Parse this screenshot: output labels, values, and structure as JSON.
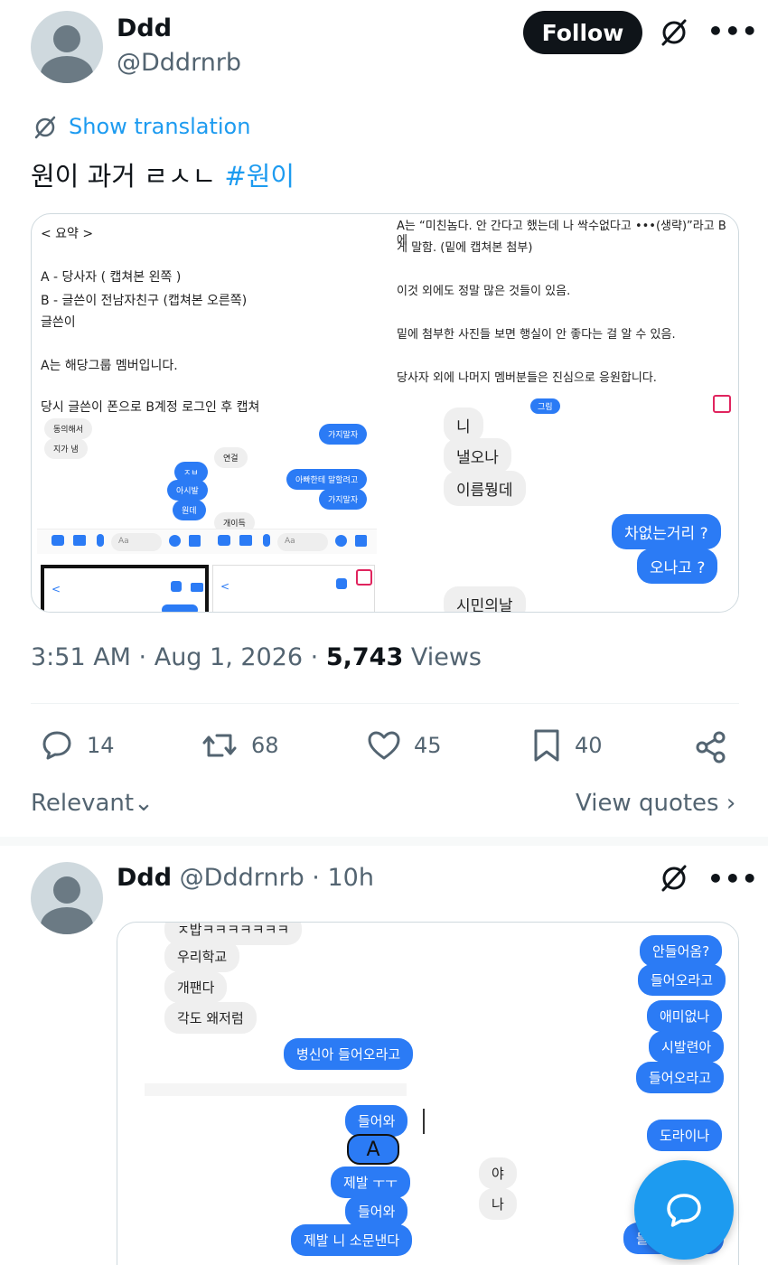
{
  "tweet": {
    "author_name": "Ddd",
    "author_handle": "@Dddrnrb",
    "follow_label": "Follow",
    "show_translation": "Show translation",
    "text_main": "원이 과거 ㄹㅅㄴ ",
    "hashtag": "#원이",
    "timestamp": "3:51 AM · Aug 1, 2026 · ",
    "views_count": "5,743",
    "views_label": " Views",
    "replies": "14",
    "retweets": "68",
    "likes": "45",
    "bookmarks": "40"
  },
  "filters": {
    "sort_label": "Relevant",
    "view_quotes": "View quotes"
  },
  "reply": {
    "author_name": "Ddd",
    "author_handle": "@Dddrnrb",
    "time": " · 10h"
  },
  "media1": {
    "left_doc": [
      "< 요약 >",
      "A - 당사자 ( 캡쳐본 왼쪽 )",
      "B - 글쓴이 전남자친구 (캡쳐본 오른쪽)",
      "글쓴이",
      "A는 해당그룹 멤버입니다.",
      "당시 글쓴이 폰으로 B계정 로그인 후 캡쳐"
    ],
    "right_doc": [
      "A는 “미친놈다. 안 간다고 했는데 나 싹수없다고 •••(생략)”라고 B에",
      "게 말함. (밑에 캡쳐본 첨부)",
      "이것 외에도 정말 많은 것들이 있음.",
      "밑에 첨부한 사진들 보면 행실이 안 좋다는 걸 알 수 있음.",
      "당사자 외에 나머지 멤버분들은 진심으로 응원합니다."
    ],
    "left_chat": [
      "동의해서",
      "지가 냄",
      "가지말자",
      "ㅈㅂ",
      "아시발",
      "원데",
      "연걸",
      "아빠한테 말할려고",
      "가지말자",
      "개이득",
      "Aa",
      "Aa"
    ],
    "right_chat": [
      "그림",
      "니",
      "낼오나",
      "이름뭥데",
      "차없는거리 ?",
      "오나고 ?",
      "시민의날"
    ]
  },
  "media2": {
    "left_chat": [
      "ㅈ밥ㅋㅋㅋㅋㅋㅋㅋ",
      "우리학교",
      "개팬다",
      "각도 왜저럼",
      "병신아 들어오라고",
      "들어와",
      "A",
      "제발 ㅜㅜ",
      "들어와",
      "제발 니 소문낸다",
      "야",
      "나"
    ],
    "right_chat": [
      "안들어옴?",
      "들어오라고",
      "애미없나",
      "시발련아",
      "들어오라고",
      "도라이나",
      "들어와라제발"
    ]
  },
  "colors": {
    "accent": "#1d9bf0",
    "text": "#0f1419",
    "muted": "#536471",
    "chat_blue": "#2b7bf5"
  }
}
